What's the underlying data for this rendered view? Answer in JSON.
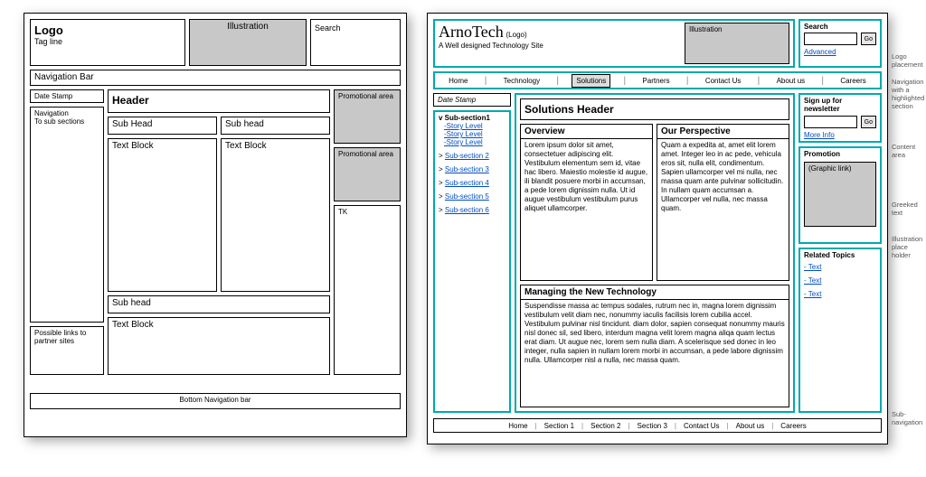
{
  "left": {
    "logo_title": "Logo",
    "logo_tagline": "Tag line",
    "illustration": "Illustration",
    "search_label": "Search",
    "nav_bar": "Navigation Bar",
    "date_stamp": "Date Stamp",
    "left_nav_line1": "Navigation",
    "left_nav_line2": "To sub sections",
    "header": "Header",
    "sub1": "Sub Head",
    "sub2": "Sub head",
    "text_block": "Text Block",
    "sub3": "Sub head",
    "promo1": "Promotional area",
    "promo2": "Promotional area",
    "tk": "TK",
    "partner": "Possible links to partner sites",
    "bottom_nav": "Bottom Navigation bar"
  },
  "right": {
    "brand": "ArnoTech",
    "brand_note": "(Logo)",
    "tagline": "A Well designed Technology Site",
    "illustration": "Illustration",
    "search_label": "Search",
    "search_btn": "Go",
    "advanced": "Advanced",
    "nav": [
      "Home",
      "Technology",
      "Solutions",
      "Partners",
      "Contact Us",
      "About us",
      "Careers"
    ],
    "date_stamp": "Date Stamp",
    "current_sub": "v Sub-section1",
    "story_levels": [
      "-Story Level",
      "-Story Level",
      "-Story Level"
    ],
    "subsections": [
      "Sub-section  2",
      "Sub-section  3",
      "Sub-section  4",
      "Sub-section  5",
      "Sub-section  6"
    ],
    "solutions_header": "Solutions Header",
    "overview_title": "Overview",
    "overview_body": "Lorem ipsum dolor sit amet, consectetuer adipiscing elit. Vestibulum elementum sem id, vitae hac libero. Maiestio molestie id augue, ili blandit posuere morbi in accumsan, a pede lorem dignissim nulla. Ut id augue vestibulum vestibulum purus aliquet ullamcorper.",
    "perspective_title": "Our Perspective",
    "perspective_body": "Quam a expedita at, amet elit lorem amet. Integer leo in ac pede, vehicula eros sit, nulla elit, condimentum. Sapien ullamcorper vel mi nulla, nec massa quam ante pulvinar sollicitudin. In nullam quam accumsan a. Ullamcorper vel nulla, nec massa quam.",
    "managing_title": "Managing the New Technology",
    "managing_body": "Suspendisse massa ac tempus sodales, rutrum nec in, magna lorem dignissim vestibulum velit diam nec, nonummy iaculis facilisis lorem cubilia accel. Vestibulum pulvinar nisl tincidunt. diam dolor, sapien consequat nonummy mauris nisl donec sil, sed libero, interdum magna velit lorem magna aliqa quam lectus erat diam. Ut augue nec, lorem sem  nulla diam. A scelerisque sed donec in leo integer, nulla sapien in nullam lorem morbi in accumsan, a pede labore dignissim nulla. Ullamcorper nisl a nulla,  nec massa quam.",
    "signup_title": "Sign up for newsletter",
    "signup_btn": "Go",
    "more_info": "More Info",
    "promotion_title": "Promotion",
    "graphic_link": "(Graphic link)",
    "related_title": "Related Topics",
    "related_items": [
      "- Text",
      "- Text",
      "- Text"
    ],
    "bottom_nav": [
      "Home",
      "Section 1",
      "Section 2",
      "Section 3",
      "Contact Us",
      "About us",
      "Careers"
    ],
    "annotations": {
      "logo": "Logo placement",
      "nav": "Navigation with a highlighted section",
      "content": "Content area",
      "greeked": "Greeked text",
      "illus": "Illustration place holder",
      "subnav": "Sub-navigation"
    }
  }
}
